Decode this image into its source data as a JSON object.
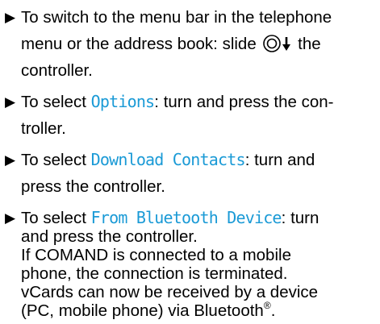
{
  "steps": [
    {
      "marker": "▶",
      "line1_a": "To switch to the menu bar in the telephone",
      "line2_a": "menu or the address book: slide",
      "line2_b": "the",
      "line3": "controller.",
      "icon": "controller-slide-down-icon"
    },
    {
      "marker": "▶",
      "line1_a": "To select",
      "line1_code": "Options",
      "line1_b": ": turn and press the con-",
      "line2": "troller."
    },
    {
      "marker": "▶",
      "line1_a": "To select",
      "line1_code": "Download Contacts",
      "line1_b": ": turn and",
      "line2": "press the controller."
    },
    {
      "marker": "▶",
      "line1_a": "To select",
      "line1_code": "From Bluetooth Device",
      "line1_b": ": turn",
      "line2": "and press the controller.",
      "line3": "If COMAND is connected to a mobile",
      "line4": "phone, the connection is terminated.",
      "line5": "vCards can now be received by a device",
      "line6_a": "(PC, mobile phone) via Bluetooth",
      "line6_sup": "®",
      "line6_b": "."
    }
  ]
}
